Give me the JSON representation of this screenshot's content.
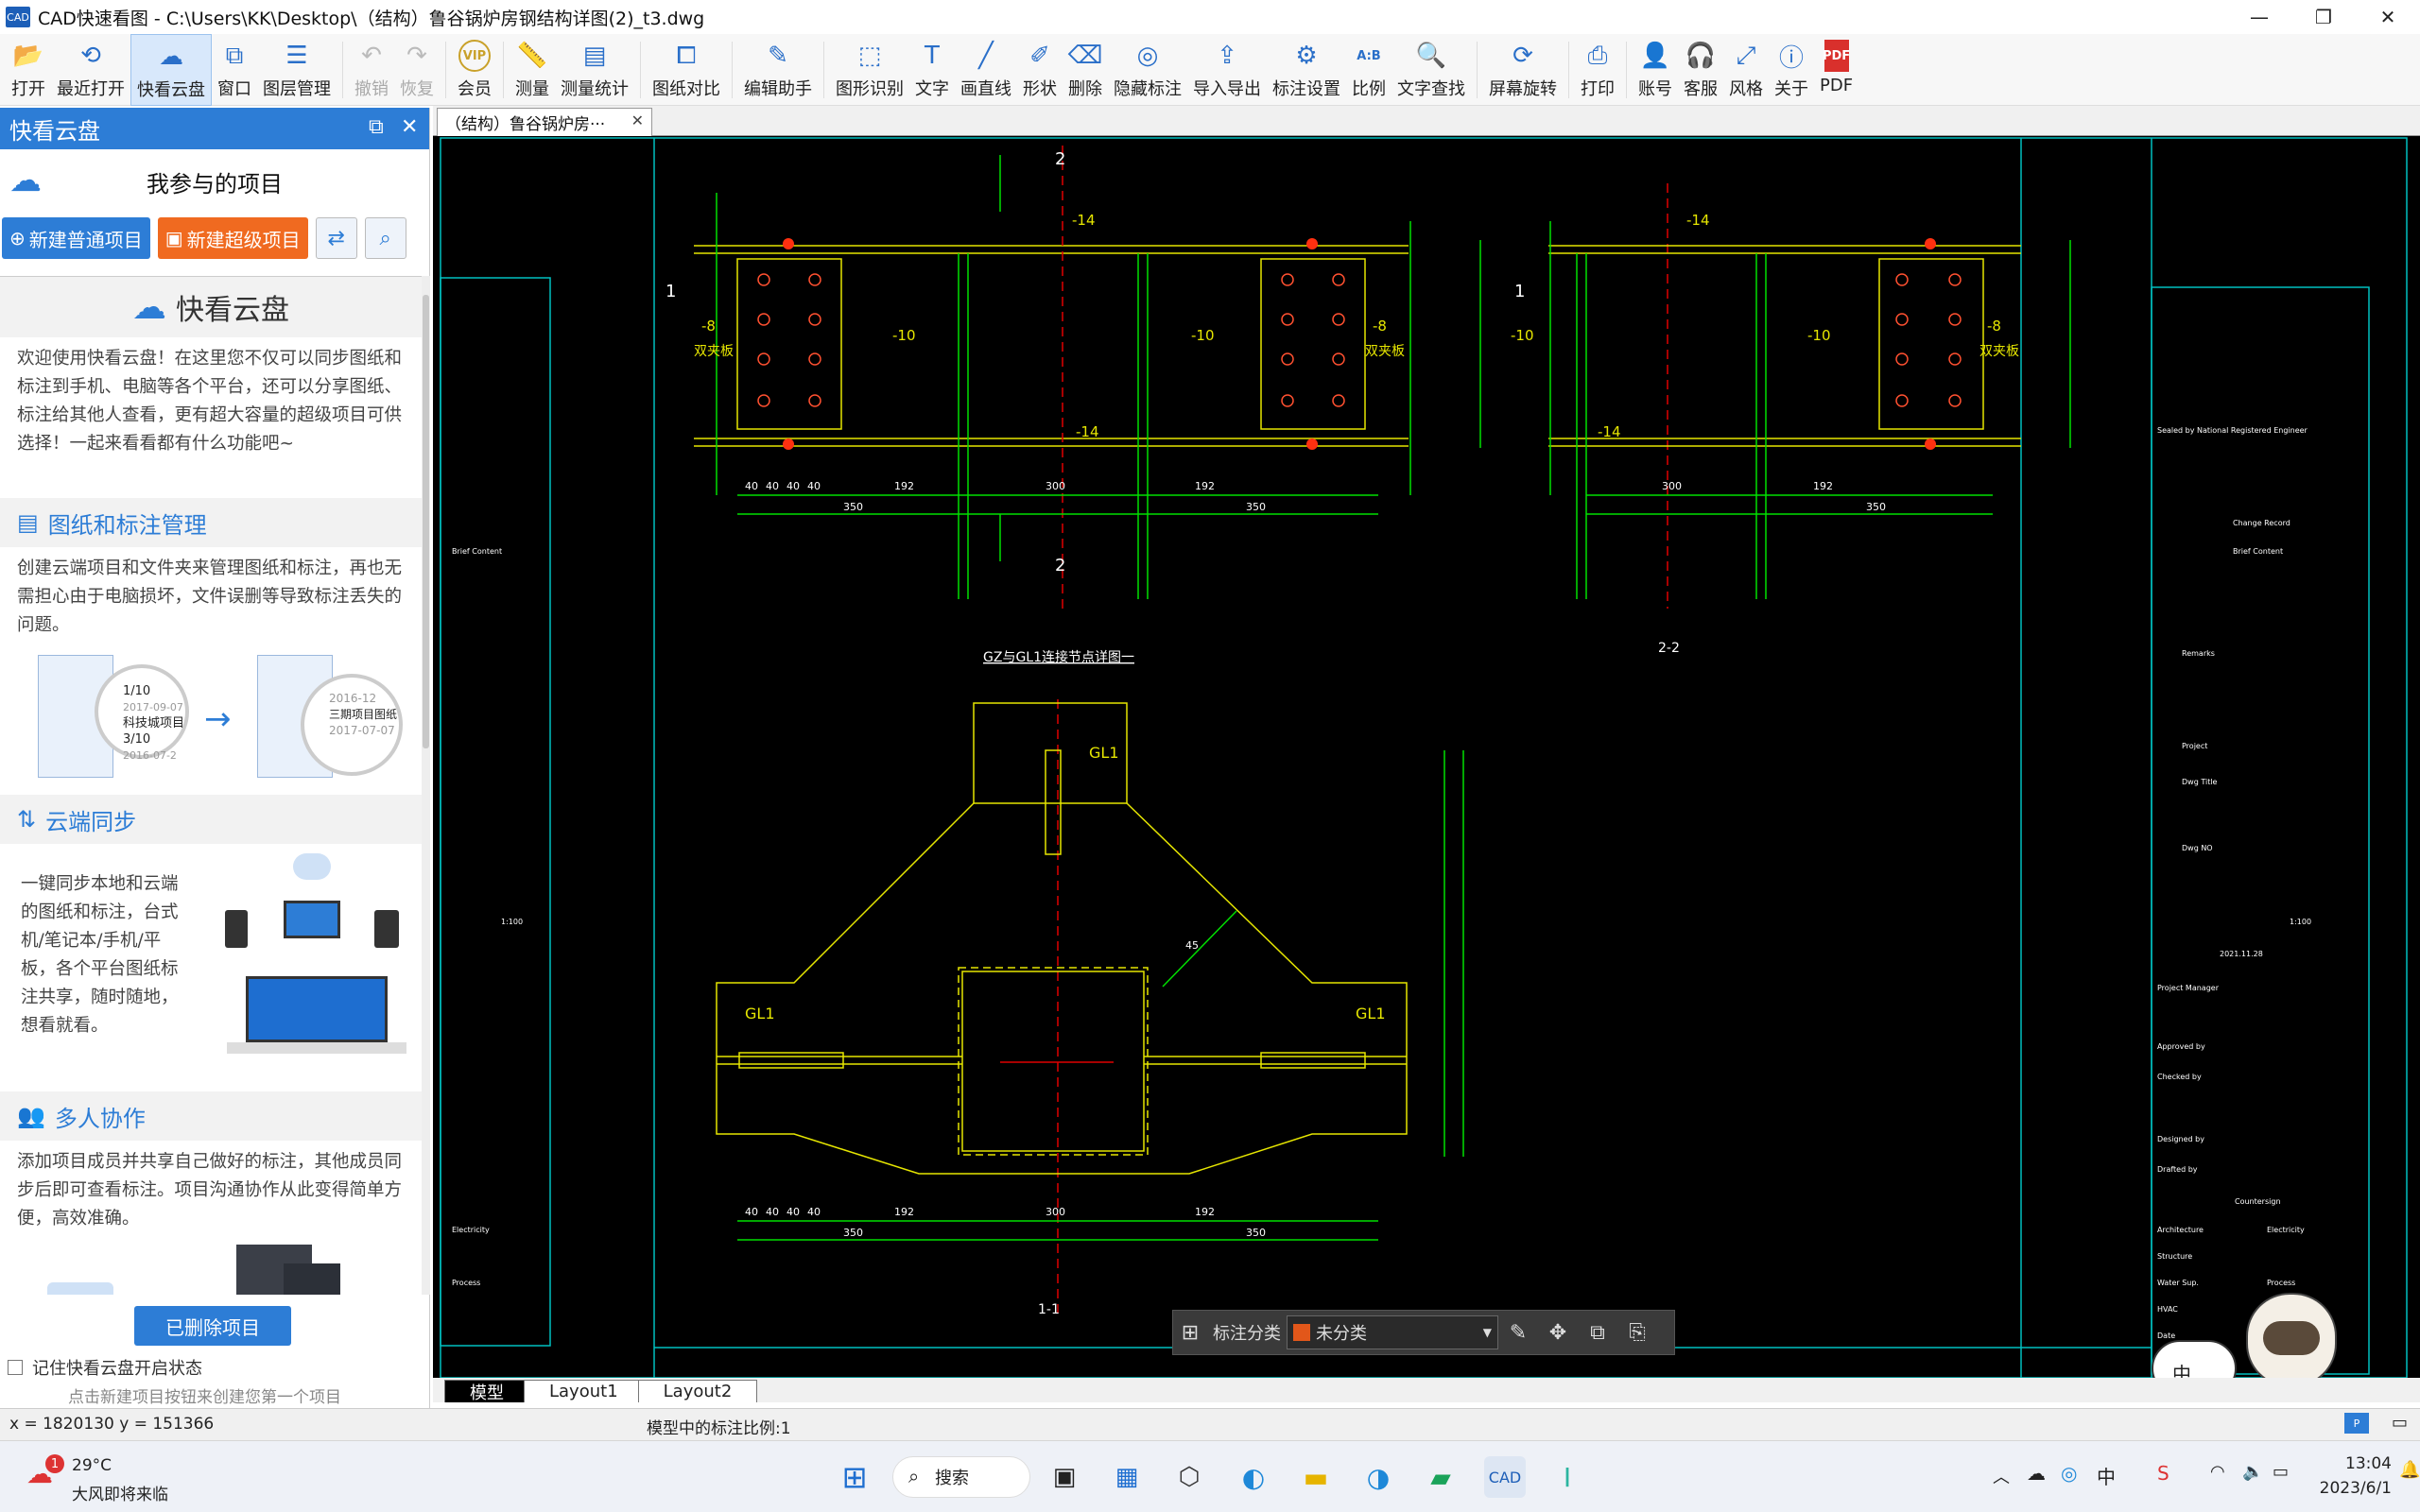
{
  "window": {
    "title": "CAD快速看图 - C:\\Users\\KK\\Desktop\\（结构）鲁谷锅炉房钢结构详图(2)_t3.dwg",
    "app_icon": "CAD",
    "minimize": "—",
    "maximize": "❐",
    "close": "✕"
  },
  "toolbar": {
    "items": [
      {
        "label": "打开",
        "icon": "folder-open-icon",
        "glyph": "📂"
      },
      {
        "label": "最近打开",
        "icon": "history-icon",
        "glyph": "⟲"
      },
      {
        "label": "快看云盘",
        "icon": "cloud-icon",
        "glyph": "☁"
      },
      {
        "label": "窗口",
        "icon": "window-icon",
        "glyph": "⧉"
      },
      {
        "label": "图层管理",
        "icon": "layers-icon",
        "glyph": "☰"
      },
      {
        "label": "撤销",
        "icon": "undo-icon",
        "glyph": "↶"
      },
      {
        "label": "恢复",
        "icon": "redo-icon",
        "glyph": "↷"
      },
      {
        "label": "会员",
        "icon": "vip-icon",
        "glyph": "VIP"
      },
      {
        "label": "测量",
        "icon": "ruler-icon",
        "glyph": "📏"
      },
      {
        "label": "测量统计",
        "icon": "measure-stats-icon",
        "glyph": "▤"
      },
      {
        "label": "图纸对比",
        "icon": "compare-icon",
        "glyph": "⧠"
      },
      {
        "label": "编辑助手",
        "icon": "cad-editor-icon",
        "glyph": "✎"
      },
      {
        "label": "图形识别",
        "icon": "shape-recognize-icon",
        "glyph": "⬚"
      },
      {
        "label": "文字",
        "icon": "text-icon",
        "glyph": "T"
      },
      {
        "label": "画直线",
        "icon": "line-icon",
        "glyph": "╱"
      },
      {
        "label": "形状",
        "icon": "shape-icon",
        "glyph": "✐"
      },
      {
        "label": "删除",
        "icon": "eraser-icon",
        "glyph": "⌫"
      },
      {
        "label": "隐藏标注",
        "icon": "hide-annotation-icon",
        "glyph": "◎"
      },
      {
        "label": "导入导出",
        "icon": "import-export-icon",
        "glyph": "⇪"
      },
      {
        "label": "标注设置",
        "icon": "annotation-settings-icon",
        "glyph": "⚙"
      },
      {
        "label": "比例",
        "icon": "scale-icon",
        "glyph": "A:B"
      },
      {
        "label": "文字查找",
        "icon": "text-search-icon",
        "glyph": "🔍"
      },
      {
        "label": "屏幕旋转",
        "icon": "rotate-screen-icon",
        "glyph": "⟳"
      },
      {
        "label": "打印",
        "icon": "printer-icon",
        "glyph": "⎙"
      },
      {
        "label": "账号",
        "icon": "user-icon",
        "glyph": "👤"
      },
      {
        "label": "客服",
        "icon": "headset-icon",
        "glyph": "🎧"
      },
      {
        "label": "风格",
        "icon": "style-icon",
        "glyph": "⤢"
      },
      {
        "label": "关于",
        "icon": "info-icon",
        "glyph": "ⓘ"
      },
      {
        "label": "PDF",
        "icon": "pdf-icon",
        "glyph": "PDF"
      }
    ]
  },
  "panel": {
    "title": "快看云盘",
    "subtitle": "我参与的项目",
    "new_normal": "新建普通项目",
    "new_super": "新建超级项目",
    "intro_title": "快看云盘",
    "intro_text": "欢迎使用快看云盘！在这里您不仅可以同步图纸和标注到手机、电脑等各个平台，还可以分享图纸、标注给其他人查看，更有超大容量的超级项目可供选择！一起来看看都有什么功能吧~",
    "sec1_title": "图纸和标注管理",
    "sec1_text": "创建云端项目和文件夹来管理图纸和标注，再也无需担心由于电脑损坏，文件误删等导致标注丢失的问题。",
    "sec1_img_a": "1/10",
    "sec1_img_b": "2017-09-07",
    "sec1_img_c": "科技城项目",
    "sec1_img_d": "3/10",
    "sec1_img_e": "2016-07-2",
    "sec1_img_f": "2016-12",
    "sec1_img_g": "三期项目图纸",
    "sec1_img_h": "2017-07-07",
    "sec2_title": "云端同步",
    "sec2_text": "一键同步本地和云端的图纸和标注，台式机/笔记本/手机/平板，各个平台图纸标注共享，随时随地，想看就看。",
    "sec3_title": "多人协作",
    "sec3_text": "添加项目成员并共享自己做好的标注，其他成员同步后即可查看标注。项目沟通协作从此变得简单方便，高效准确。",
    "deleted_btn": "已删除项目",
    "remember_label": "记住快看云盘开启状态",
    "hint": "点击新建项目按钮来创建您第一个项目"
  },
  "document": {
    "tab_label": "（结构）鲁谷锅炉房···",
    "layouts": [
      "模型",
      "Layout1",
      "Layout2"
    ]
  },
  "drawing": {
    "sec_22_top": "2",
    "sec_22_bot": "2",
    "sec_11_left": "1",
    "sec_11_right": "1",
    "plate_14": "-14",
    "plate_10": "-10",
    "plate_8": "-8",
    "splice": "双夹板",
    "title_main": "GZ与GL1连接节点详图一",
    "title_22": "2-2",
    "title_11": "1-1",
    "gl1": "GL1",
    "dim_40": "40",
    "dim_192": "192",
    "dim_300": "300",
    "dim_350": "350",
    "dim_45": "45",
    "tb_engineer": "Sealed by National Registered Engineer",
    "tb_change": "Change Record",
    "tb_brief": "Brief Content",
    "tb_remarks": "Remarks",
    "tb_project": "Project",
    "tb_dwgtitle": "Dwg Title",
    "tb_dwgno": "Dwg NO",
    "tb_scale": "1:100",
    "tb_date": "2021.11.28",
    "tb_manager": "Project Manager",
    "tb_approved": "Approved by",
    "tb_checked": "Checked by",
    "tb_designed": "Designed by",
    "tb_drafted": "Drafted by",
    "tb_counter": "Countersign",
    "tb_arch": "Architecture",
    "tb_elec": "Electricity",
    "tb_struct": "Structure",
    "tb_water": "Water Sup.",
    "tb_hvac": "HVAC",
    "tb_process": "Process",
    "tb_date2": "Date"
  },
  "annotation_bar": {
    "label": "标注分类",
    "category": "未分类",
    "category_color": "#e2571a"
  },
  "status": {
    "coords": "x = 1820130  y = 151366",
    "scale": "模型中的标注比例:1"
  },
  "ime": {
    "label": "中"
  },
  "taskbar": {
    "weather_temp": "29°C",
    "weather_desc": "大风即将来临",
    "weather_badge": "1",
    "search": "搜索",
    "time": "13:04",
    "date": "2023/6/1",
    "tray_ime": "中"
  }
}
